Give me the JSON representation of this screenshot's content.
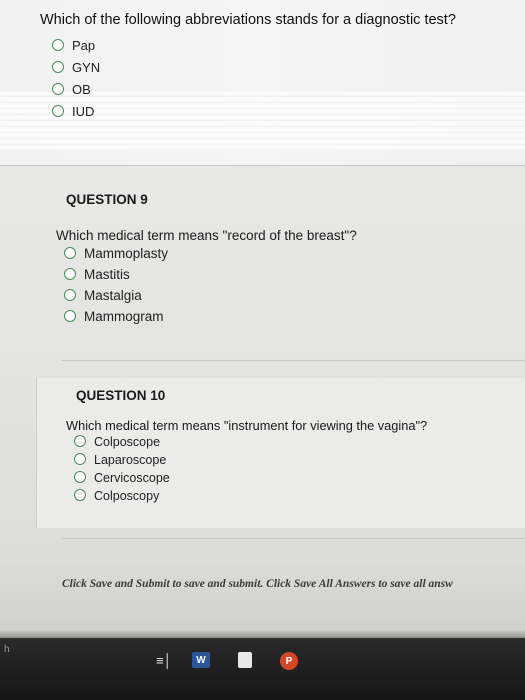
{
  "question8": {
    "prompt": "Which of the following abbreviations stands for a diagnostic test?",
    "options": [
      "Pap",
      "GYN",
      "OB",
      "IUD"
    ]
  },
  "question9": {
    "title": "QUESTION 9",
    "prompt": "Which medical term means \"record of the breast\"?",
    "options": [
      "Mammoplasty",
      "Mastitis",
      "Mastalgia",
      "Mammogram"
    ]
  },
  "question10": {
    "title": "QUESTION 10",
    "prompt": "Which medical term means \"instrument for viewing the vagina\"?",
    "options": [
      "Colposcope",
      "Laparoscope",
      "Cervicoscope",
      "Colposcopy"
    ]
  },
  "footer": {
    "instructions": "Click Save and Submit to save and submit. Click Save All Answers to save all answ"
  },
  "taskbar": {
    "left_fragment": "h",
    "word_icon_label": "W",
    "icons": [
      "task-view-icon",
      "word-icon",
      "document-icon",
      "powerpoint-icon"
    ]
  },
  "colors": {
    "radio_border": "#4a8a5a",
    "taskbar_bg": "#161616",
    "word_blue": "#2b579a",
    "powerpoint_orange": "#d24726"
  }
}
